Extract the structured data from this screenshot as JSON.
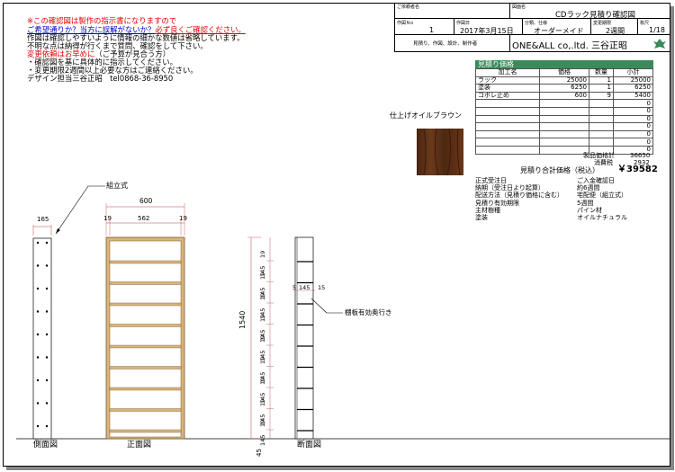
{
  "notes": {
    "line1": "※この確認図は製作の指示書になりますので",
    "line2_a": "ご希望通りか？当方に誤解がないか？",
    "line2_b": "必ず良くご確認ください。",
    "line3": "作図は確認しやすいように情報の細かな数値は省略しています。",
    "line4": "不明な点は納得が行くまで質問、確認をして下さい。",
    "line5_a": "変更依頼はお早めに",
    "line5_b": "（ご予算が見合う方）",
    "line6": "・確認図を基に具体的に指示してください。",
    "line7": "・変更期限2週間以上必要な方はご連絡ください。",
    "line8": "デザイン担当三谷正昭　tel0868-36-8950"
  },
  "header": {
    "customer_label": "ご依頼者名",
    "drawing_label": "図面名",
    "drawing_name": "CDラック見積り確認図",
    "no_label": "作図Ｎo",
    "no_value": "1",
    "date_label": "作図日",
    "date_value": "2017年3月15日",
    "category_label": "分類、仕様",
    "category_value": "オーダーメイド",
    "period_label": "変更期限",
    "period_value": "2週間",
    "sheet_label": "枚尺",
    "sheet_value": "1/18",
    "company_label": "見積り、作図、設計、制作者",
    "company_value": "ONE&ALL co,.ltd. 三谷正昭"
  },
  "estimate": {
    "title": "見積り価格",
    "headers": [
      "加工名",
      "価格",
      "数量",
      "小計"
    ],
    "rows": [
      [
        "ラック",
        "25000",
        "1",
        "25000"
      ],
      [
        "塗装",
        "6250",
        "1",
        "6250"
      ],
      [
        "コボレ止め",
        "600",
        "9",
        "5400"
      ],
      [
        "",
        "",
        "",
        "0"
      ],
      [
        "",
        "",
        "",
        "0"
      ],
      [
        "",
        "",
        "",
        "0"
      ],
      [
        "",
        "",
        "",
        "0"
      ],
      [
        "",
        "",
        "",
        "0"
      ],
      [
        "",
        "",
        "",
        "0"
      ],
      [
        "",
        "",
        "",
        "0"
      ]
    ],
    "product_total_label": "製品価格計",
    "product_total": "36650",
    "tax_label": "消費税",
    "tax": "2932",
    "grand_label": "見積り合計価格（税込）",
    "grand_value": "￥39582"
  },
  "conditions": [
    [
      "正式受注日",
      "ご入金確認日"
    ],
    [
      "納期（受注日より起算）",
      "約6週間"
    ],
    [
      "配送方法（見積り価格に含む）",
      "宅配便（組立式）"
    ],
    [
      "見積り有効期限",
      "5週間"
    ],
    [
      "主材樹種",
      "パイン材"
    ],
    [
      "塗装",
      "オイルナチュラル"
    ]
  ],
  "finish_label": "仕上げオイルブラウン",
  "drawing": {
    "assembly_label": "組立式",
    "shelf_depth_label": "棚板有効奥行き",
    "side_view": "側面図",
    "front_view": "正面図",
    "section_view": "断面図",
    "dim_165": "165",
    "dim_600": "600",
    "dim_19a": "19",
    "dim_562": "562",
    "dim_19b": "19",
    "dim_1540": "1540",
    "dim_5": "5",
    "dim_145": "145",
    "dim_15": "15",
    "dim_19": "19",
    "dim_45": "45"
  },
  "colors": {
    "accent": "#3a8a5c",
    "red": "#e00000",
    "blue": "#0000cc",
    "wood": "#c9a36a"
  }
}
